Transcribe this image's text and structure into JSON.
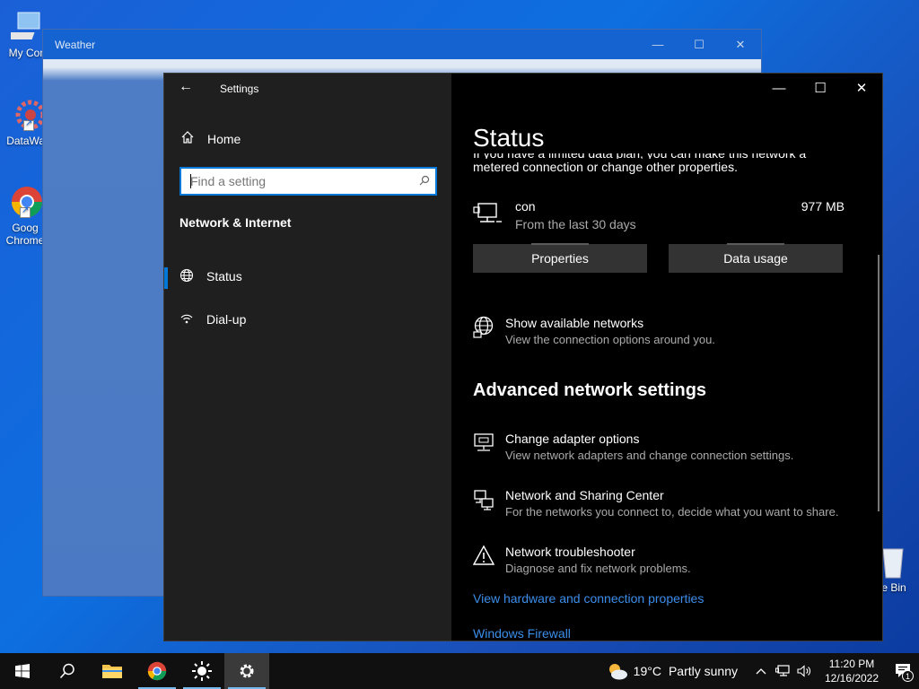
{
  "desktop": {
    "icons": [
      {
        "label": "My Com"
      },
      {
        "label": "DataWag"
      },
      {
        "label": "Goog Chrome"
      },
      {
        "label": "e Bin"
      }
    ]
  },
  "weather_window": {
    "title": "Weather"
  },
  "settings": {
    "title": "Settings",
    "nav": {
      "home_label": "Home",
      "search_placeholder": "Find a setting",
      "section_label": "Network & Internet",
      "items": [
        {
          "label": "Status",
          "selected": true
        },
        {
          "label": "Dial-up",
          "selected": false
        }
      ]
    },
    "content": {
      "page_title": "Status",
      "clipped_line": "If you have a limited data plan, you can make this network a",
      "clipped_line2": "metered connection or change other properties.",
      "connection_name": "con",
      "connection_period": "From the last 30 days",
      "data_used": "977 MB",
      "properties_button": "Properties",
      "data_usage_button": "Data usage",
      "show_networks": {
        "label": "Show available networks",
        "desc": "View the connection options around you."
      },
      "advanced_heading": "Advanced network settings",
      "advanced_items": [
        {
          "label": "Change adapter options",
          "desc": "View network adapters and change connection settings."
        },
        {
          "label": "Network and Sharing Center",
          "desc": "For the networks you connect to, decide what you want to share."
        },
        {
          "label": "Network troubleshooter",
          "desc": "Diagnose and fix network problems."
        }
      ],
      "links": [
        "View hardware and connection properties",
        "Windows Firewall"
      ]
    }
  },
  "taskbar": {
    "weather_temp": "19°C",
    "weather_condition": "Partly sunny",
    "time": "11:20 PM",
    "date": "12/16/2022",
    "notification_count": "1"
  },
  "colors": {
    "accent": "#0078d7",
    "link": "#3b8eea",
    "desktop": "#1463d0"
  }
}
